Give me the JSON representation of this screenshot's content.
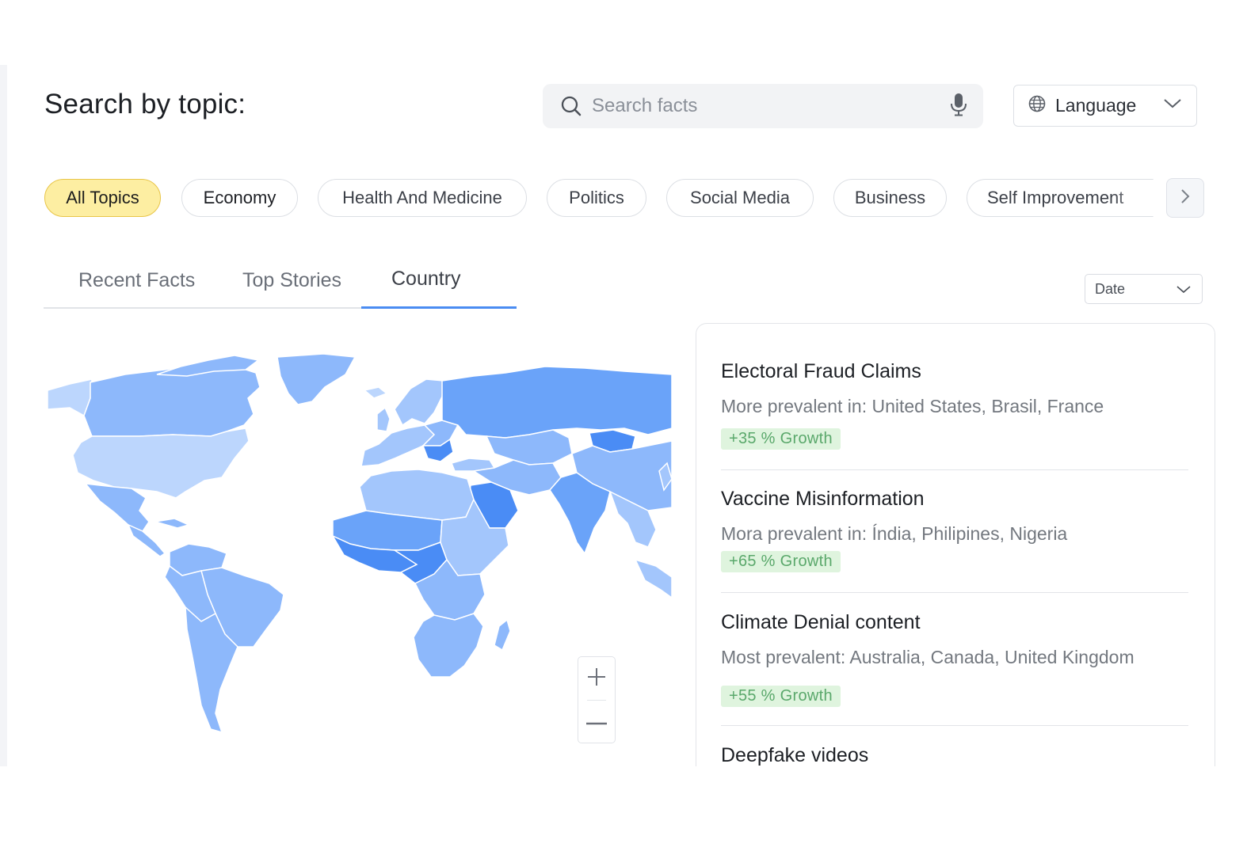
{
  "header": {
    "title": "Search by topic:",
    "search": {
      "placeholder": "Search facts",
      "value": ""
    },
    "language": {
      "label": "Language"
    }
  },
  "topics": [
    {
      "label": "All Topics",
      "active": true
    },
    {
      "label": "Economy",
      "active": false
    },
    {
      "label": "Health And Medicine",
      "active": false
    },
    {
      "label": "Politics",
      "active": false
    },
    {
      "label": "Social Media",
      "active": false
    },
    {
      "label": "Business",
      "active": false
    },
    {
      "label": "Self Improvement",
      "active": false
    }
  ],
  "tabs": [
    {
      "label": "Recent Facts",
      "active": false
    },
    {
      "label": "Top Stories",
      "active": false
    },
    {
      "label": "Country",
      "active": true
    }
  ],
  "sort": {
    "label": "Date"
  },
  "facts": [
    {
      "title": "Electoral Fraud Claims",
      "description": "More prevalent in: United States, Brasil, France",
      "growth": "+35 % Growth"
    },
    {
      "title": "Vaccine Misinformation",
      "description": "Mora prevalent in: Índia, Philipines, Nigeria",
      "growth": "+65 % Growth"
    },
    {
      "title": "Climate Denial content",
      "description": "Most prevalent: Australia, Canada, United Kingdom",
      "growth": "+55 % Growth"
    },
    {
      "title": "Deepfake videos",
      "description": "",
      "growth": ""
    }
  ],
  "map_colors": {
    "lightest": "#bcd6fd",
    "light": "#a3c6fc",
    "medium": "#8db8fb",
    "strong": "#6aa3f9",
    "darkest": "#4a8cf5"
  },
  "icons": {
    "search": "search-icon",
    "mic": "microphone-icon",
    "globe": "globe-icon",
    "chevron": "chevron-down-icon",
    "next": "chevron-right-icon",
    "zoom_in": "plus-icon",
    "zoom_out": "minus-icon"
  }
}
